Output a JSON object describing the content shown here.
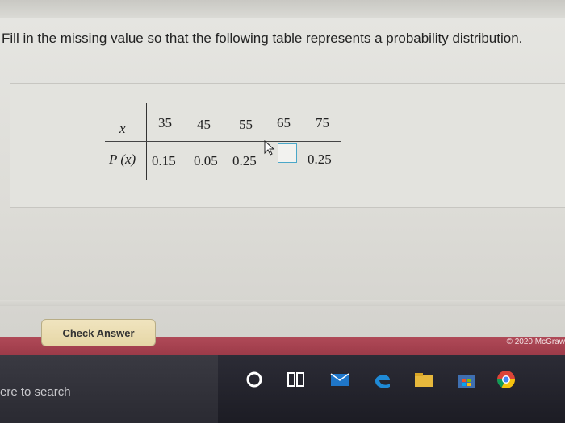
{
  "question": {
    "text": "Fill in the missing value so that the following table represents a probability distribution."
  },
  "table": {
    "x_header": "x",
    "p_header": "P (x)",
    "x_values": [
      "35",
      "45",
      "55",
      "65",
      "75"
    ],
    "p_values": [
      "0.15",
      "0.05",
      "0.25",
      "",
      "0.25"
    ]
  },
  "buttons": {
    "check_answer": "Check Answer"
  },
  "footer": {
    "copyright": "© 2020 McGraw"
  },
  "taskbar": {
    "search_text": "ere to search",
    "icons": [
      "cortana-icon",
      "task-view-icon",
      "mail-icon",
      "edge-icon",
      "file-explorer-icon",
      "store-icon",
      "chrome-icon"
    ]
  },
  "colors": {
    "button_bg": "#e9dcae",
    "footer_bar": "#a6414f",
    "taskbar_bg": "#24242c",
    "input_border": "#4aa7c8"
  }
}
